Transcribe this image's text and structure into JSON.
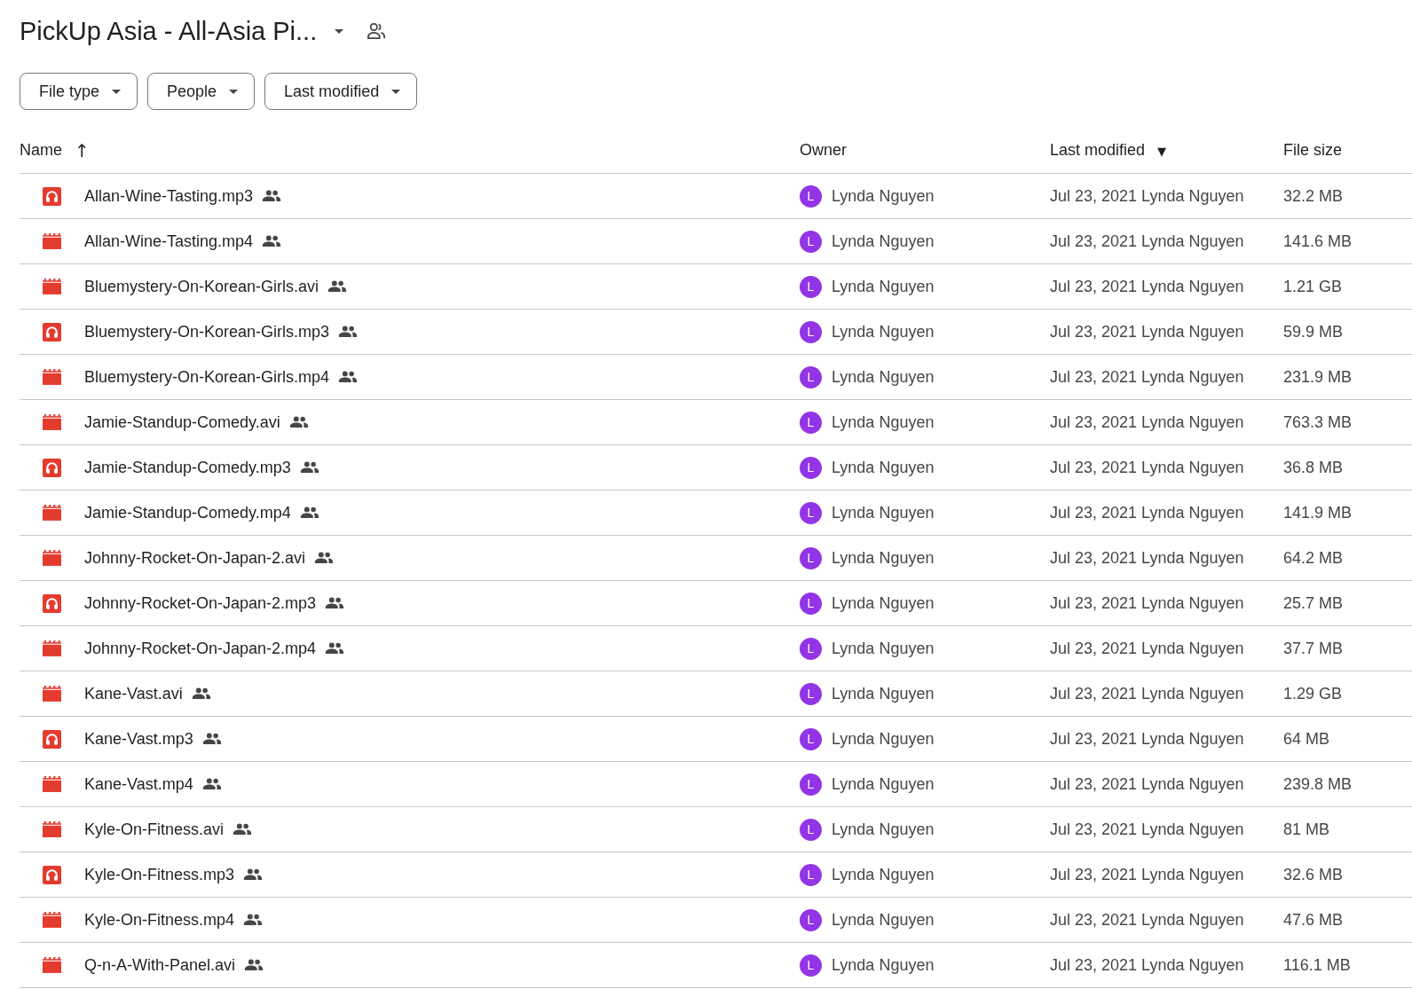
{
  "header": {
    "title": "PickUp Asia - All-Asia Pi..."
  },
  "filters": [
    "File type",
    "People",
    "Last modified"
  ],
  "table": {
    "columns": [
      {
        "label": "Name",
        "sort_icon": "↑"
      },
      {
        "label": "Owner"
      },
      {
        "label": "Last modified",
        "sort_icon": "▾"
      },
      {
        "label": "File size"
      }
    ],
    "rows": [
      {
        "kind": "audio",
        "name": "Allan-Wine-Tasting.mp3",
        "owner_initial": "L",
        "owner": "Lynda Nguyen",
        "modified": "Jul 23, 2021 Lynda Nguyen",
        "size": "32.2 MB"
      },
      {
        "kind": "video",
        "name": "Allan-Wine-Tasting.mp4",
        "owner_initial": "L",
        "owner": "Lynda Nguyen",
        "modified": "Jul 23, 2021 Lynda Nguyen",
        "size": "141.6 MB"
      },
      {
        "kind": "video",
        "name": "Bluemystery-On-Korean-Girls.avi",
        "owner_initial": "L",
        "owner": "Lynda Nguyen",
        "modified": "Jul 23, 2021 Lynda Nguyen",
        "size": "1.21 GB"
      },
      {
        "kind": "audio",
        "name": "Bluemystery-On-Korean-Girls.mp3",
        "owner_initial": "L",
        "owner": "Lynda Nguyen",
        "modified": "Jul 23, 2021 Lynda Nguyen",
        "size": "59.9 MB"
      },
      {
        "kind": "video",
        "name": "Bluemystery-On-Korean-Girls.mp4",
        "owner_initial": "L",
        "owner": "Lynda Nguyen",
        "modified": "Jul 23, 2021 Lynda Nguyen",
        "size": "231.9 MB"
      },
      {
        "kind": "video",
        "name": "Jamie-Standup-Comedy.avi",
        "owner_initial": "L",
        "owner": "Lynda Nguyen",
        "modified": "Jul 23, 2021 Lynda Nguyen",
        "size": "763.3 MB"
      },
      {
        "kind": "audio",
        "name": "Jamie-Standup-Comedy.mp3",
        "owner_initial": "L",
        "owner": "Lynda Nguyen",
        "modified": "Jul 23, 2021 Lynda Nguyen",
        "size": "36.8 MB"
      },
      {
        "kind": "video",
        "name": "Jamie-Standup-Comedy.mp4",
        "owner_initial": "L",
        "owner": "Lynda Nguyen",
        "modified": "Jul 23, 2021 Lynda Nguyen",
        "size": "141.9 MB"
      },
      {
        "kind": "video",
        "name": "Johnny-Rocket-On-Japan-2.avi",
        "owner_initial": "L",
        "owner": "Lynda Nguyen",
        "modified": "Jul 23, 2021 Lynda Nguyen",
        "size": "64.2 MB"
      },
      {
        "kind": "audio",
        "name": "Johnny-Rocket-On-Japan-2.mp3",
        "owner_initial": "L",
        "owner": "Lynda Nguyen",
        "modified": "Jul 23, 2021 Lynda Nguyen",
        "size": "25.7 MB"
      },
      {
        "kind": "video",
        "name": "Johnny-Rocket-On-Japan-2.mp4",
        "owner_initial": "L",
        "owner": "Lynda Nguyen",
        "modified": "Jul 23, 2021 Lynda Nguyen",
        "size": "37.7 MB"
      },
      {
        "kind": "video",
        "name": "Kane-Vast.avi",
        "owner_initial": "L",
        "owner": "Lynda Nguyen",
        "modified": "Jul 23, 2021 Lynda Nguyen",
        "size": "1.29 GB"
      },
      {
        "kind": "audio",
        "name": "Kane-Vast.mp3",
        "owner_initial": "L",
        "owner": "Lynda Nguyen",
        "modified": "Jul 23, 2021 Lynda Nguyen",
        "size": "64 MB"
      },
      {
        "kind": "video",
        "name": "Kane-Vast.mp4",
        "owner_initial": "L",
        "owner": "Lynda Nguyen",
        "modified": "Jul 23, 2021 Lynda Nguyen",
        "size": "239.8 MB"
      },
      {
        "kind": "video",
        "name": "Kyle-On-Fitness.avi",
        "owner_initial": "L",
        "owner": "Lynda Nguyen",
        "modified": "Jul 23, 2021 Lynda Nguyen",
        "size": "81 MB"
      },
      {
        "kind": "audio",
        "name": "Kyle-On-Fitness.mp3",
        "owner_initial": "L",
        "owner": "Lynda Nguyen",
        "modified": "Jul 23, 2021 Lynda Nguyen",
        "size": "32.6 MB"
      },
      {
        "kind": "video",
        "name": "Kyle-On-Fitness.mp4",
        "owner_initial": "L",
        "owner": "Lynda Nguyen",
        "modified": "Jul 23, 2021 Lynda Nguyen",
        "size": "47.6 MB"
      },
      {
        "kind": "video",
        "name": "Q-n-A-With-Panel.avi",
        "owner_initial": "L",
        "owner": "Lynda Nguyen",
        "modified": "Jul 23, 2021 Lynda Nguyen",
        "size": "116.1 MB"
      }
    ]
  }
}
